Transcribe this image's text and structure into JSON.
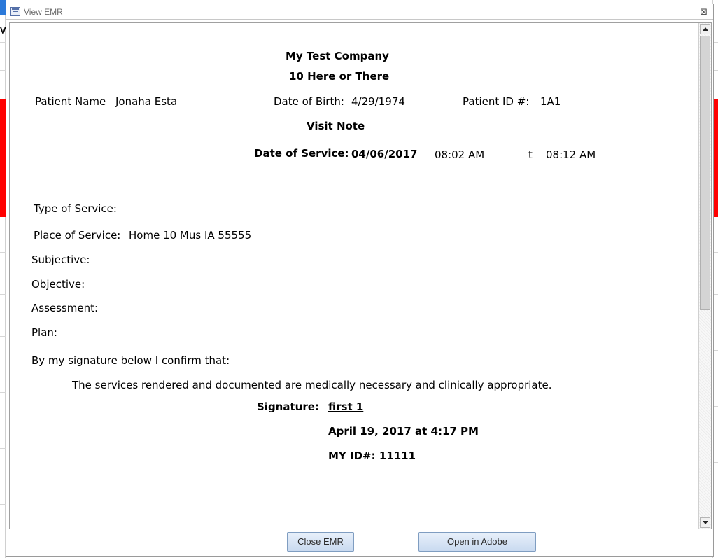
{
  "window": {
    "title": "View EMR",
    "close_glyph": "⊠"
  },
  "background": {
    "partial_label": "V"
  },
  "report": {
    "company_name": "My Test Company",
    "company_address": "10 Here or There",
    "patient_name_label": "Patient Name",
    "patient_name": "Jonaha Esta",
    "dob_label": "Date of Birth:",
    "dob": "4/29/1974",
    "patient_id_label": "Patient ID #:",
    "patient_id": "1A1",
    "note_title": "Visit Note",
    "date_of_service_label": "Date of Service:",
    "date_of_service": "04/06/2017",
    "time_start": "08:02 AM",
    "time_sep": "t",
    "time_end": "08:12 AM",
    "type_of_service_label": "Type of Service:",
    "type_of_service": "",
    "place_of_service_label": "Place of Service:",
    "place_of_service": "Home 10  Mus IA 55555",
    "subjective_label": "Subjective:",
    "objective_label": "Objective:",
    "assessment_label": "Assessment:",
    "plan_label": "Plan:",
    "confirm_intro": "By my signature below I confirm that:",
    "confirm_statement": "The services rendered and documented are medically necessary and clinically appropriate.",
    "signature_label": "Signature:",
    "signature_name": "first 1",
    "signature_date": "April 19, 2017 at 4:17 PM",
    "signer_id": "MY ID#: 11111"
  },
  "buttons": {
    "close_label": "Close EMR",
    "adobe_label": "Open in Adobe"
  },
  "colors": {
    "background_red": "#ff0000",
    "background_blue": "#2b79d9",
    "button_border": "#7f9dc1"
  }
}
